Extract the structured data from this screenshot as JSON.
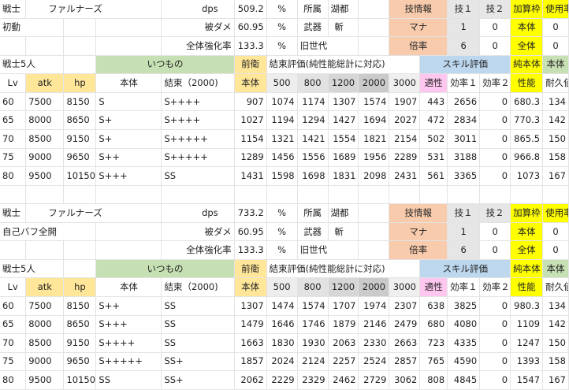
{
  "sections": [
    {
      "info": {
        "job": "戦士",
        "name": "ファルナーズ",
        "dps_label": "dps",
        "dps": "509.2",
        "percent": "%",
        "affil_label": "所属",
        "affil": "湖都",
        "skillinfo": "技情報",
        "skill1": "技１",
        "skill2": "技２",
        "addcap": "加算枠",
        "usage": "使用率",
        "mode": "初動",
        "dmg_label": "被ダメ",
        "dmg": "60.95",
        "percent2": "%",
        "weapon_label": "武器",
        "weapon": "斬",
        "mana_label": "マナ",
        "mana1": "1",
        "mana2": "0",
        "body_label": "本体",
        "body_val": "0",
        "boost_label": "全体強化率",
        "boost": "133.3",
        "percent3": "%",
        "gen_label": "旧世代",
        "mult_label": "倍率",
        "mult1": "6",
        "mult2": "0",
        "all_label": "全体",
        "all_val": "0"
      },
      "header1": {
        "team": "戦士5人",
        "itsumono": "いつもの",
        "zeneei": "前衛",
        "kessoku": "結束評価(純性能総計に対応)",
        "skilleval": "スキル評価",
        "junseino": "純本体",
        "body2": "本体"
      },
      "header2": {
        "lv": "Lv",
        "atk": "atk",
        "hp": "hp",
        "body": "本体",
        "kessoku2000": "結束（2000)",
        "body_z": "本体",
        "k500": "500",
        "k800": "800",
        "k1200": "1200",
        "k2000": "2000",
        "k3000": "3000",
        "tekisei": "適性",
        "eff1": "効率１",
        "eff2": "効率２",
        "perf": "性能",
        "dur": "耐久値"
      },
      "rows": [
        [
          "60",
          "7500",
          "8150",
          "S",
          "S++++",
          "907",
          "1074",
          "1174",
          "1307",
          "1574",
          "1907",
          "443",
          "2656",
          "0",
          "680.3",
          "134"
        ],
        [
          "65",
          "8000",
          "8650",
          "S+",
          "S++++",
          "1027",
          "1194",
          "1294",
          "1427",
          "1694",
          "2027",
          "472",
          "2834",
          "0",
          "770.3",
          "142"
        ],
        [
          "70",
          "8500",
          "9150",
          "S+",
          "S+++++",
          "1154",
          "1321",
          "1421",
          "1554",
          "1821",
          "2154",
          "502",
          "3011",
          "0",
          "865.5",
          "150"
        ],
        [
          "75",
          "9000",
          "9650",
          "S++",
          "S+++++",
          "1289",
          "1456",
          "1556",
          "1689",
          "1956",
          "2289",
          "531",
          "3188",
          "0",
          "966.8",
          "158"
        ],
        [
          "80",
          "9500",
          "10150",
          "S+++",
          "SS",
          "1431",
          "1598",
          "1698",
          "1831",
          "2098",
          "2431",
          "561",
          "3365",
          "0",
          "1073",
          "167"
        ]
      ]
    },
    {
      "info": {
        "job": "戦士",
        "name": "ファルナーズ",
        "dps_label": "dps",
        "dps": "733.2",
        "percent": "%",
        "affil_label": "所属",
        "affil": "湖都",
        "skillinfo": "技情報",
        "skill1": "技１",
        "skill2": "技２",
        "addcap": "加算枠",
        "usage": "使用率",
        "mode": "自己バフ全開",
        "dmg_label": "被ダメ",
        "dmg": "60.95",
        "percent2": "%",
        "weapon_label": "武器",
        "weapon": "斬",
        "mana_label": "マナ",
        "mana1": "1",
        "mana2": "0",
        "body_label": "本体",
        "body_val": "0",
        "boost_label": "全体強化率",
        "boost": "133.3",
        "percent3": "%",
        "gen_label": "旧世代",
        "mult_label": "倍率",
        "mult1": "6",
        "mult2": "0",
        "all_label": "全体",
        "all_val": "0"
      },
      "header1": {
        "team": "戦士5人",
        "itsumono": "いつもの",
        "zeneei": "前衛",
        "kessoku": "結束評価(純性能総計に対応)",
        "skilleval": "スキル評価",
        "junseino": "純本体",
        "body2": "本体"
      },
      "header2": {
        "lv": "Lv",
        "atk": "atk",
        "hp": "hp",
        "body": "本体",
        "kessoku2000": "結束（2000)",
        "body_z": "本体",
        "k500": "500",
        "k800": "800",
        "k1200": "1200",
        "k2000": "2000",
        "k3000": "3000",
        "tekisei": "適性",
        "eff1": "効率１",
        "eff2": "効率２",
        "perf": "性能",
        "dur": "耐久値"
      },
      "rows": [
        [
          "60",
          "7500",
          "8150",
          "S++",
          "SS",
          "1307",
          "1474",
          "1574",
          "1707",
          "1974",
          "2307",
          "638",
          "3825",
          "0",
          "980.3",
          "134"
        ],
        [
          "65",
          "8000",
          "8650",
          "S+++",
          "SS",
          "1479",
          "1646",
          "1746",
          "1879",
          "2146",
          "2479",
          "680",
          "4080",
          "0",
          "1109",
          "142"
        ],
        [
          "70",
          "8500",
          "9150",
          "S++++",
          "SS",
          "1663",
          "1830",
          "1930",
          "2063",
          "2330",
          "2663",
          "723",
          "4335",
          "0",
          "1247",
          "150"
        ],
        [
          "75",
          "9000",
          "9650",
          "S+++++",
          "SS+",
          "1857",
          "2024",
          "2124",
          "2257",
          "2524",
          "2857",
          "765",
          "4590",
          "0",
          "1393",
          "158"
        ],
        [
          "80",
          "9500",
          "10150",
          "SS",
          "SS+",
          "2062",
          "2229",
          "2329",
          "2462",
          "2729",
          "3062",
          "808",
          "4845",
          "0",
          "1547",
          "167"
        ]
      ]
    }
  ]
}
